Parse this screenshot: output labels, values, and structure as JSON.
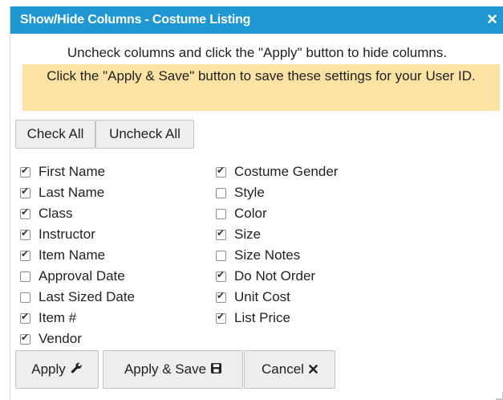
{
  "dialog": {
    "title": "Show/Hide Columns - Costume Listing",
    "close_icon": "×",
    "message": "Uncheck columns and click the \"Apply\" button to hide columns.",
    "note": "Click the \"Apply & Save\" button to save these settings for your User ID.",
    "colors": {
      "titlebar": "#1f97d2",
      "note_bg": "#fce3a3"
    }
  },
  "bulk": {
    "check_all": "Check All",
    "uncheck_all": "Uncheck All"
  },
  "columns_left": [
    {
      "label": "First Name",
      "checked": true
    },
    {
      "label": "Last Name",
      "checked": true
    },
    {
      "label": "Class",
      "checked": true
    },
    {
      "label": "Instructor",
      "checked": true
    },
    {
      "label": "Item Name",
      "checked": true
    },
    {
      "label": "Approval Date",
      "checked": false
    },
    {
      "label": "Last Sized Date",
      "checked": false
    },
    {
      "label": "Item #",
      "checked": true
    },
    {
      "label": "Vendor",
      "checked": true
    }
  ],
  "columns_right": [
    {
      "label": "Costume Gender",
      "checked": true
    },
    {
      "label": "Style",
      "checked": false
    },
    {
      "label": "Color",
      "checked": false
    },
    {
      "label": "Size",
      "checked": true
    },
    {
      "label": "Size Notes",
      "checked": false
    },
    {
      "label": "Do Not Order",
      "checked": true
    },
    {
      "label": "Unit Cost",
      "checked": true
    },
    {
      "label": "List Price",
      "checked": true
    }
  ],
  "actions": {
    "apply": "Apply",
    "apply_icon": "wrench-icon",
    "apply_save": "Apply & Save",
    "apply_save_icon": "save-icon",
    "cancel": "Cancel",
    "cancel_icon": "close-icon"
  }
}
